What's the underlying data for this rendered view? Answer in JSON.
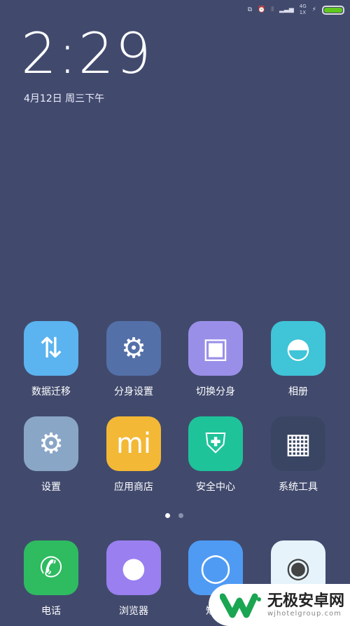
{
  "status_bar": {
    "network_top": "4G",
    "network_bottom": "1X",
    "battery_level": 1.0,
    "battery_color": "#5fc71e",
    "icons": [
      "dual-app-icon",
      "alarm-icon",
      "vibrate-icon",
      "signal-icon",
      "charging-icon",
      "battery-icon"
    ]
  },
  "lockscreen": {
    "time": "2:29",
    "date": "4月12日 周三下午"
  },
  "apps": [
    {
      "label": "数据迁移",
      "color": "#5bb3ef",
      "icon": "data-transfer-icon"
    },
    {
      "label": "分身设置",
      "color": "#5470a8",
      "icon": "gears-icon"
    },
    {
      "label": "切换分身",
      "color": "#9a8fe8",
      "icon": "switch-icon"
    },
    {
      "label": "相册",
      "color": "#3fc4d8",
      "icon": "gallery-icon"
    },
    {
      "label": "设置",
      "color": "#8aa6c6",
      "icon": "gear-icon"
    },
    {
      "label": "应用商店",
      "color": "#f3b835",
      "icon": "mi-store-icon",
      "icon_text": "mi"
    },
    {
      "label": "安全中心",
      "color": "#1fc39a",
      "icon": "shield-icon"
    },
    {
      "label": "系统工具",
      "color": "#3a4563",
      "icon": "folder-icon"
    }
  ],
  "page_indicator": {
    "pages": 2,
    "current": 1
  },
  "dock": [
    {
      "label": "电话",
      "color": "#2fbb60",
      "icon": "phone-icon"
    },
    {
      "label": "浏览器",
      "color": "#9a7ff0",
      "icon": "browser-icon"
    },
    {
      "label": "短信",
      "color": "#4f9bf4",
      "icon": "message-icon"
    },
    {
      "label": "",
      "color": "#e6f3fb",
      "icon": "camera-icon"
    }
  ],
  "watermark": {
    "title": "无极安卓网",
    "url": "wjhotelgroup.com"
  }
}
